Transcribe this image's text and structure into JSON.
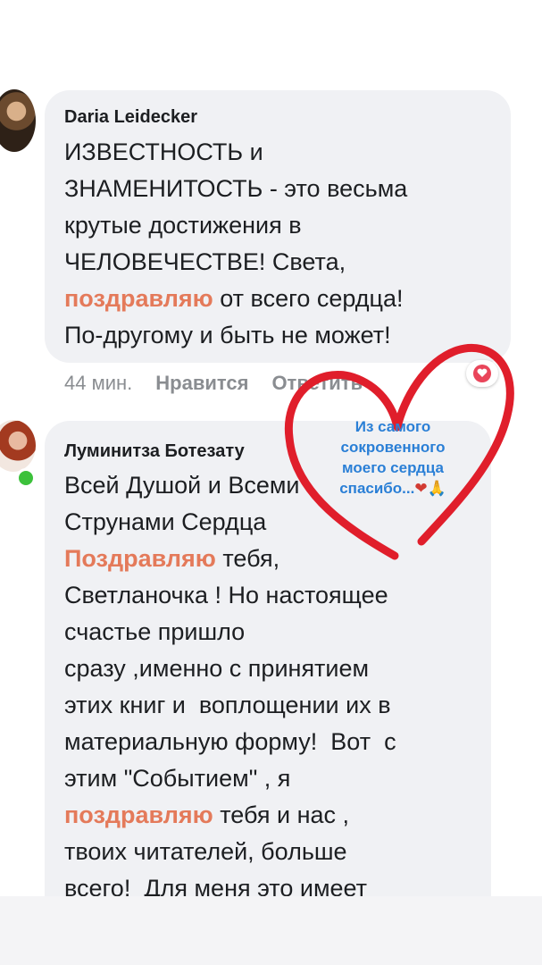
{
  "comments": [
    {
      "author": "Daria Leidecker",
      "text_lines": [
        [
          {
            "t": "ИЗВЕСТНОСТЬ и",
            "hl": false
          }
        ],
        [
          {
            "t": "ЗНАМЕНИТОСТЬ - это весьма",
            "hl": false
          }
        ],
        [
          {
            "t": "крутые достижения в",
            "hl": false
          }
        ],
        [
          {
            "t": "ЧЕЛОВЕЧЕСТВЕ! Света,",
            "hl": false
          }
        ],
        [
          {
            "t": "поздравляю",
            "hl": true
          },
          {
            "t": " от всего сердца!",
            "hl": false
          }
        ],
        [
          {
            "t": "По-другому и быть не может!",
            "hl": false
          }
        ]
      ],
      "time": "44 мин.",
      "like_label": "Нравится",
      "reply_label": "Ответить",
      "reaction_icon": "heart-icon"
    },
    {
      "author": "Луминитза Ботезату",
      "online": true,
      "text_lines": [
        [
          {
            "t": "Всей Душой и Всеми",
            "hl": false
          }
        ],
        [
          {
            "t": "Струнами Сердца",
            "hl": false
          }
        ],
        [
          {
            "t": "Поздравляю",
            "hl": true
          },
          {
            "t": " тебя,",
            "hl": false
          }
        ],
        [
          {
            "t": "Светланочка ! Но настоящее",
            "hl": false
          }
        ],
        [
          {
            "t": "счастье пришло",
            "hl": false
          }
        ],
        [
          {
            "t": "сразу ,именно с принятием",
            "hl": false
          }
        ],
        [
          {
            "t": "этих книг и  воплощении их в",
            "hl": false
          }
        ],
        [
          {
            "t": "материальную форму!  Вот  с",
            "hl": false
          }
        ],
        [
          {
            "t": "этим \"Событием\" , я",
            "hl": false
          }
        ],
        [
          {
            "t": "поздравляю",
            "hl": true
          },
          {
            "t": " тебя и нас ,",
            "hl": false
          }
        ],
        [
          {
            "t": "твоих читателей, больше",
            "hl": false
          }
        ],
        [
          {
            "t": "всего!  Для меня это имеет",
            "hl": false
          }
        ]
      ]
    }
  ],
  "sticker": {
    "lines": [
      "Из самого",
      "сокровенного",
      "моего сердца"
    ],
    "last_line": "спасибо...",
    "last_emoji": "❤🙏"
  },
  "colors": {
    "highlight": "#e47a5a",
    "heart_drawing": "#e01e2b",
    "sticker_text": "#2a7fd6"
  }
}
